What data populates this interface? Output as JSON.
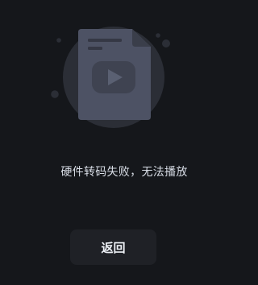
{
  "error": {
    "message": "硬件转码失败，无法播放",
    "icon": "file-video-error-icon"
  },
  "actions": {
    "back_label": "返回"
  },
  "colors": {
    "background": "#15171b",
    "circle": "#2b2e36",
    "file": "#4d5264",
    "button": "#1f2126",
    "text": "#d8dde6"
  }
}
